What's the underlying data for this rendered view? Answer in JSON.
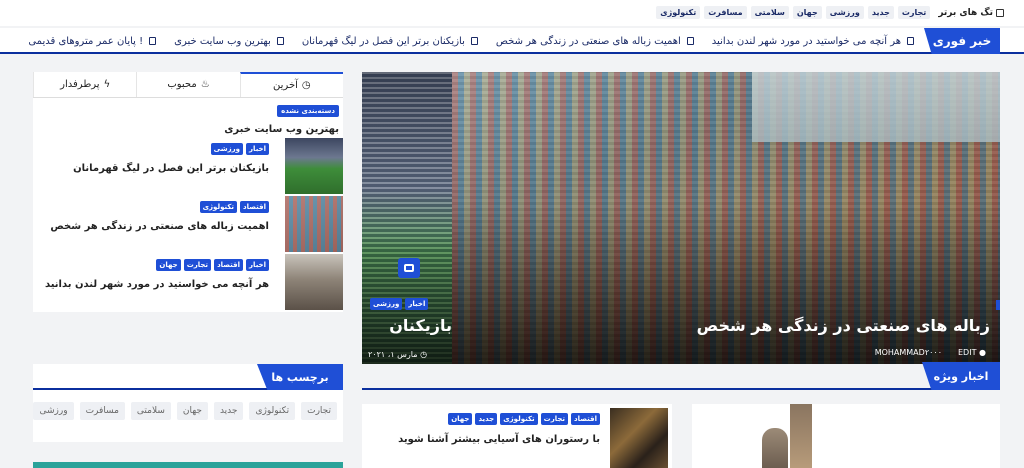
{
  "tagbar": {
    "title": "تگ های برتر",
    "tags": [
      "تجارت",
      "جدید",
      "ورزشی",
      "جهان",
      "سلامتی",
      "مسافرت",
      "تکنولوژی"
    ]
  },
  "breaking": {
    "label": "خبر فوری",
    "items": [
      "هر آنچه می خواستید در مورد شهر لندن بدانید",
      "اهمیت زباله های صنعتی در زندگی هر شخص",
      "بازیکنان برتر این فصل در لیگ قهرمانان",
      "بهترین وب سایت خبری",
      "! پایان عمر متروهای قدیمی"
    ]
  },
  "hero": {
    "title": "زباله های صنعتی در زندگی هر شخص",
    "author": "MOHAMMAD۲۰۰۰",
    "edit": "EDIT",
    "side_title": "بازیکنان",
    "side_tags": [
      "اخبار",
      "ورزشی"
    ],
    "side_date": "مارس ۱، ۲۰۲۱"
  },
  "widget": {
    "tabs": [
      "آخرین",
      "محبوب",
      "پرطرفدار"
    ],
    "category_badge": "دسته‌بندی نشده",
    "post1_title": "بهترین وب سایت خبری",
    "posts": [
      {
        "tags": [
          "اخبار",
          "ورزشی"
        ],
        "title": "بازیکنان برتر این فصل در لیگ قهرمانان"
      },
      {
        "tags": [
          "اقتصاد",
          "تکنولوژی"
        ],
        "title": "اهمیت زباله های صنعتی در زندگی هر شخص"
      },
      {
        "tags": [
          "اخبار",
          "اقتصاد",
          "تجارت",
          "جهان"
        ],
        "title": "هر آنچه می خواستید در مورد شهر لندن بدانید"
      }
    ]
  },
  "tagwidget": {
    "header": "برچسب ها",
    "tags": [
      "تجارت",
      "تکنولوژی",
      "جدید",
      "جهان",
      "سلامتی",
      "مسافرت",
      "ورزشی"
    ]
  },
  "special": {
    "label": "اخبار ویژه",
    "card": {
      "tags": [
        "اقتصاد",
        "تجارت",
        "تکنولوژی",
        "جدید",
        "جهان"
      ],
      "title": "با رستوران های آسیایی بیشتر آشنا شوید"
    }
  },
  "colors": {
    "accent": "#1f4fd6",
    "dark_accent": "#0b2f9e",
    "background": "#f2f3f5"
  }
}
